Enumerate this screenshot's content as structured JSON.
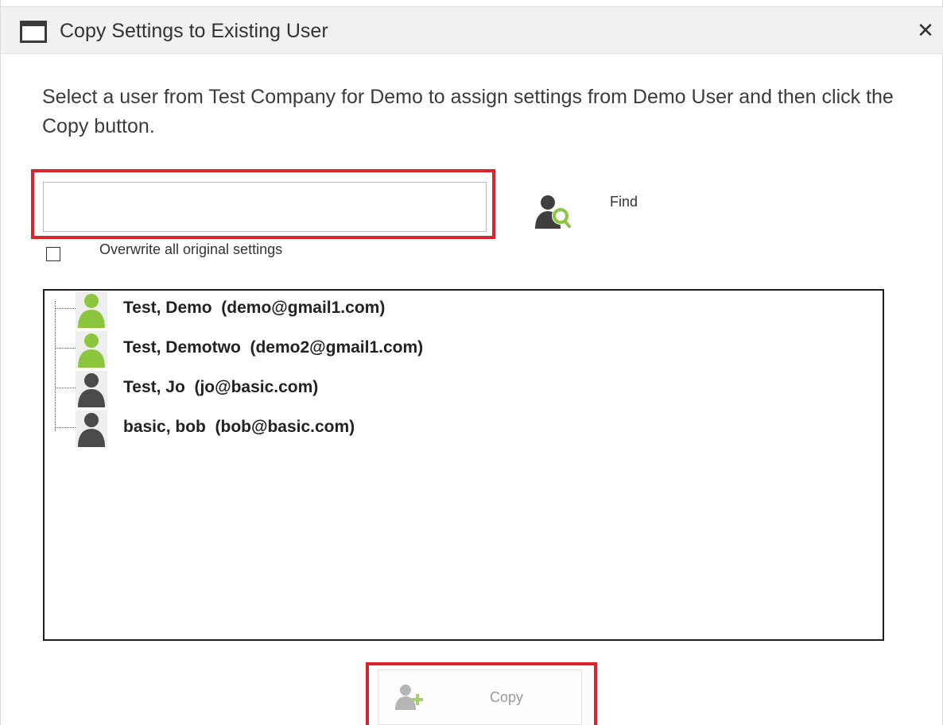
{
  "dialog": {
    "title": "Copy Settings to Existing User",
    "close_glyph": "✕",
    "instructions": "Select a user from Test Company for Demo to assign settings from Demo User and then click the Copy button."
  },
  "search": {
    "value": "",
    "placeholder": "",
    "find_label": "Find",
    "find_icon": "find-user-icon"
  },
  "overwrite": {
    "label": "Overwrite all original settings",
    "checked": false
  },
  "users": [
    {
      "label": "Test, Demo  (demo@gmail1.com)",
      "avatar_color": "#8cc63f"
    },
    {
      "label": "Test, Demotwo  (demo2@gmail1.com)",
      "avatar_color": "#8cc63f"
    },
    {
      "label": "Test, Jo  (jo@basic.com)",
      "avatar_color": "#4a4a4a"
    },
    {
      "label": "basic, bob  (bob@basic.com)",
      "avatar_color": "#4a4a4a"
    }
  ],
  "copy_button": {
    "label": "Copy",
    "icon": "add-user-icon",
    "enabled": false
  },
  "colors": {
    "highlight": "#d9232d",
    "title_bar": "#f1f1f1",
    "active_user": "#8cc63f",
    "inactive_user": "#4a4a4a"
  }
}
